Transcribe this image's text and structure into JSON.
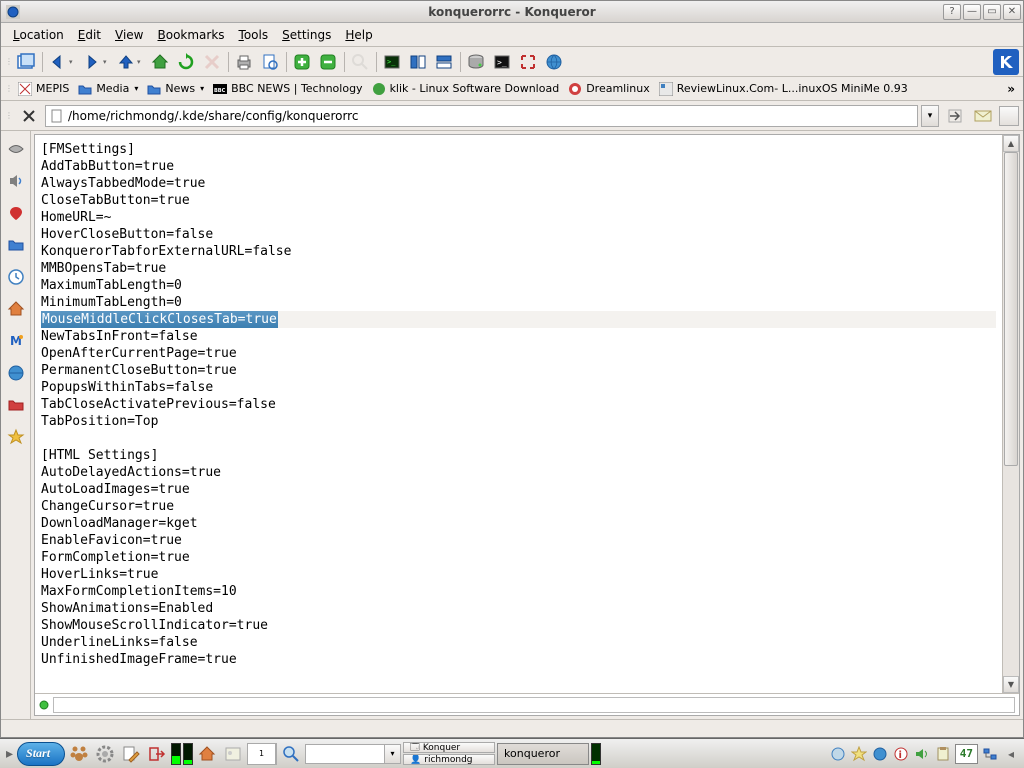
{
  "window": {
    "title": "konquerorrc - Konqueror"
  },
  "menu": {
    "location": "Location",
    "edit": "Edit",
    "view": "View",
    "bookmarks": "Bookmarks",
    "tools": "Tools",
    "settings": "Settings",
    "help": "Help"
  },
  "bookmarks": [
    {
      "label": "MEPIS"
    },
    {
      "label": "Media"
    },
    {
      "label": "News"
    },
    {
      "label": "BBC NEWS | Technology"
    },
    {
      "label": "klik - Linux Software Download"
    },
    {
      "label": "Dreamlinux"
    },
    {
      "label": "ReviewLinux.Com- L...inuxOS MiniMe 0.93"
    }
  ],
  "bookmarks_more": "»",
  "location_path": "/home/richmondg/.kde/share/config/konquerorrc",
  "editor_lines": [
    "[FMSettings]",
    "AddTabButton=true",
    "AlwaysTabbedMode=true",
    "CloseTabButton=true",
    "HomeURL=~",
    "HoverCloseButton=false",
    "KonquerorTabforExternalURL=false",
    "MMBOpensTab=true",
    "MaximumTabLength=0",
    "MinimumTabLength=0",
    "MouseMiddleClickClosesTab=true",
    "NewTabsInFront=false",
    "OpenAfterCurrentPage=true",
    "PermanentCloseButton=true",
    "PopupsWithinTabs=false",
    "TabCloseActivatePrevious=false",
    "TabPosition=Top",
    "",
    "[HTML Settings]",
    "AutoDelayedActions=true",
    "AutoLoadImages=true",
    "ChangeCursor=true",
    "DownloadManager=kget",
    "EnableFavicon=true",
    "FormCompletion=true",
    "HoverLinks=true",
    "MaxFormCompletionItems=10",
    "ShowAnimations=Enabled",
    "ShowMouseScrollIndicator=true",
    "UnderlineLinks=false",
    "UnfinishedImageFrame=true"
  ],
  "highlighted_line_index": 10,
  "taskbar": {
    "start": "Start",
    "items": [
      {
        "label": "Konquer"
      },
      {
        "label": "konqueror"
      },
      {
        "label": "richmondg"
      }
    ],
    "clock": "47"
  },
  "desktop_pager": {
    "current": "1"
  }
}
